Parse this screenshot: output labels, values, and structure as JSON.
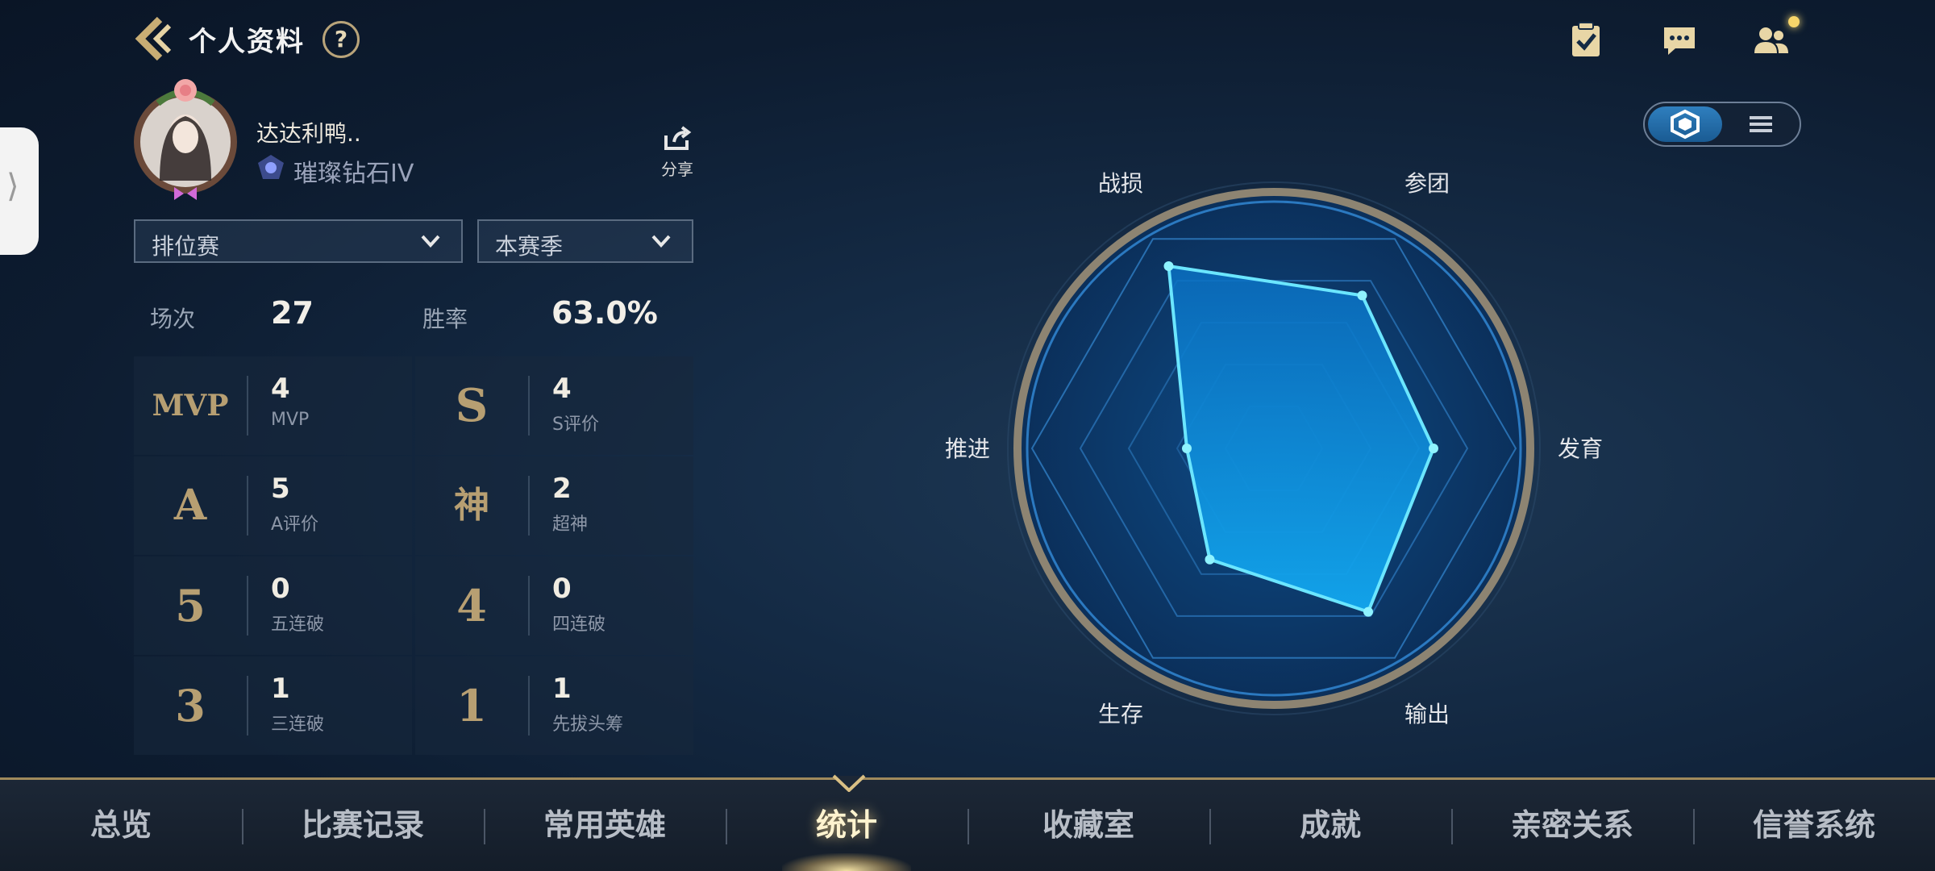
{
  "header": {
    "title": "个人资料",
    "help_label": "?",
    "icons": [
      "back-arrow-icon",
      "help-icon",
      "task-checklist-icon",
      "chat-icon",
      "friends-icon"
    ]
  },
  "side_handle": {
    "glyph": "⟩"
  },
  "profile": {
    "username": "达达利鸭..",
    "rank": "璀璨钻石IV",
    "share_label": "分享"
  },
  "filters": {
    "mode": "排位赛",
    "season": "本赛季"
  },
  "summary": {
    "matches_label": "场次",
    "matches_value": "27",
    "winrate_label": "胜率",
    "winrate_value": "63.0%"
  },
  "stats_grid": [
    {
      "badge": "MVP",
      "value": "4",
      "label": "MVP"
    },
    {
      "badge": "S",
      "value": "4",
      "label": "S评价"
    },
    {
      "badge": "A",
      "value": "5",
      "label": "A评价"
    },
    {
      "badge": "神",
      "value": "2",
      "label": "超神"
    },
    {
      "badge": "5",
      "value": "0",
      "label": "五连破"
    },
    {
      "badge": "4",
      "value": "0",
      "label": "四连破"
    },
    {
      "badge": "3",
      "value": "1",
      "label": "三连破"
    },
    {
      "badge": "1",
      "value": "1",
      "label": "先拔头筹"
    }
  ],
  "radar": {
    "axes": [
      "战损",
      "参团",
      "发育",
      "输出",
      "生存",
      "推进"
    ],
    "values": [
      0.87,
      0.73,
      0.66,
      0.78,
      0.53,
      0.36
    ]
  },
  "view_toggle": {
    "options": [
      "radar-view",
      "list-view"
    ],
    "selected": "radar-view"
  },
  "bottom_nav": {
    "tabs": [
      "总览",
      "比赛记录",
      "常用英雄",
      "统计",
      "收藏室",
      "成就",
      "亲密关系",
      "信誉系统"
    ],
    "active_index": 3
  },
  "colors": {
    "accent_gold": "#b79f72",
    "radar_fill": "#0fa0e8",
    "radar_stroke": "#6be6ff",
    "background": "#142a44"
  }
}
